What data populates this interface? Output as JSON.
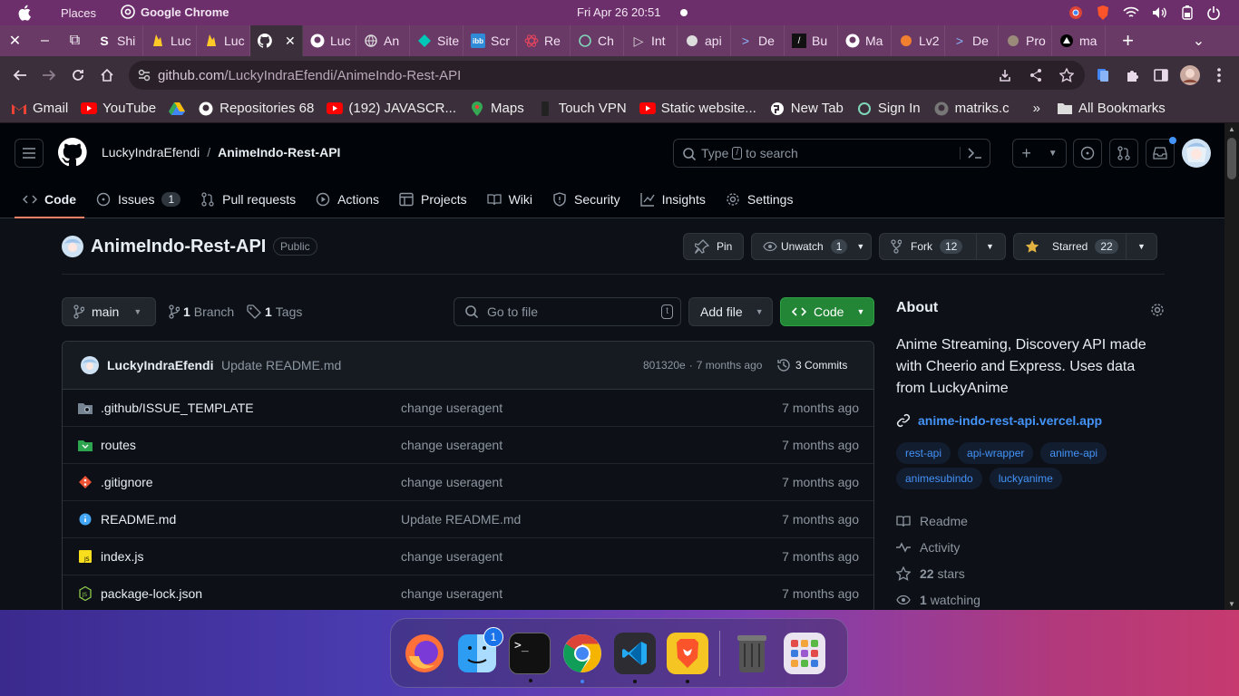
{
  "system": {
    "places": "Places",
    "app_name": "Google Chrome",
    "clock": "Fri Apr 26  20:51"
  },
  "tabs": [
    {
      "label": "Shi",
      "icon": "s-icon"
    },
    {
      "label": "Luc",
      "icon": "firebase-icon"
    },
    {
      "label": "Luc",
      "icon": "firebase-icon"
    },
    {
      "label": "",
      "icon": "github-icon",
      "active": true
    },
    {
      "label": "Luc",
      "icon": "github-icon"
    },
    {
      "label": "An",
      "icon": "globe-icon"
    },
    {
      "label": "Site",
      "icon": "diamond-icon"
    },
    {
      "label": "Scr",
      "icon": "ibb-icon"
    },
    {
      "label": "Re",
      "icon": "react-icon"
    },
    {
      "label": "Ch",
      "icon": "openai-icon"
    },
    {
      "label": "Int",
      "icon": "play-icon"
    },
    {
      "label": "api",
      "icon": "globe-icon"
    },
    {
      "label": "De",
      "icon": "powershell-icon"
    },
    {
      "label": "Bu",
      "icon": "box-icon"
    },
    {
      "label": "Ma",
      "icon": "github-icon"
    },
    {
      "label": "Lv2",
      "icon": "ball-icon"
    },
    {
      "label": "De",
      "icon": "powershell-icon"
    },
    {
      "label": "Pro",
      "icon": "gear-icon"
    },
    {
      "label": "ma",
      "icon": "triangle-icon"
    }
  ],
  "address": {
    "host": "github.com",
    "path": "/LuckyIndraEfendi/AnimeIndo-Rest-API"
  },
  "bookmarks": [
    {
      "label": "Gmail",
      "icon": "gmail-icon"
    },
    {
      "label": "YouTube",
      "icon": "youtube-icon"
    },
    {
      "label": "",
      "icon": "drive-icon"
    },
    {
      "label": "Repositories 68",
      "icon": "github-icon"
    },
    {
      "label": "(192) JAVASCR...",
      "icon": "youtube-icon"
    },
    {
      "label": "Maps",
      "icon": "maps-icon"
    },
    {
      "label": "Touch VPN",
      "icon": "vpn-icon"
    },
    {
      "label": "Static website...",
      "icon": "youtube-icon"
    },
    {
      "label": "New Tab",
      "icon": "globe-icon"
    },
    {
      "label": "Sign In",
      "icon": "openai-icon"
    },
    {
      "label": "matriks.c",
      "icon": "github-icon"
    }
  ],
  "all_bookmarks": "All Bookmarks",
  "github": {
    "owner": "LuckyIndraEfendi",
    "separator": "/",
    "repo": "AnimeIndo-Rest-API",
    "search_placeholder_a": "Type",
    "search_key": "/",
    "search_placeholder_b": "to search",
    "nav": [
      {
        "label": "Code",
        "icon": "code-icon",
        "selected": true
      },
      {
        "label": "Issues",
        "icon": "issue-icon",
        "count": "1"
      },
      {
        "label": "Pull requests",
        "icon": "pull-request-icon"
      },
      {
        "label": "Actions",
        "icon": "play-icon"
      },
      {
        "label": "Projects",
        "icon": "table-icon"
      },
      {
        "label": "Wiki",
        "icon": "book-icon"
      },
      {
        "label": "Security",
        "icon": "shield-icon"
      },
      {
        "label": "Insights",
        "icon": "graph-icon"
      },
      {
        "label": "Settings",
        "icon": "gear-icon"
      }
    ]
  },
  "repo": {
    "name": "AnimeIndo-Rest-API",
    "visibility": "Public",
    "pin": "Pin",
    "unwatch": "Unwatch",
    "watch_count": "1",
    "fork": "Fork",
    "fork_count": "12",
    "starred": "Starred",
    "star_count": "22",
    "branch": "main",
    "branches_count": "1",
    "branches_label": "Branch",
    "tags_count": "1",
    "tags_label": "Tags",
    "goto_placeholder": "Go to file",
    "goto_key": "t",
    "add_file": "Add file",
    "code_btn": "Code"
  },
  "commit": {
    "author": "LuckyIndraEfendi",
    "message": "Update README.md",
    "hash": "801320e",
    "sep": "·",
    "time": "7 months ago",
    "count": "3 Commits"
  },
  "files": [
    {
      "name": ".github/ISSUE_TEMPLATE",
      "message": "change useragent",
      "date": "7 months ago",
      "icon": "folder-icon"
    },
    {
      "name": "routes",
      "message": "change useragent",
      "date": "7 months ago",
      "icon": "folder-icon"
    },
    {
      "name": ".gitignore",
      "message": "change useragent",
      "date": "7 months ago",
      "icon": "git-icon"
    },
    {
      "name": "README.md",
      "message": "Update README.md",
      "date": "7 months ago",
      "icon": "info-icon"
    },
    {
      "name": "index.js",
      "message": "change useragent",
      "date": "7 months ago",
      "icon": "js-icon"
    },
    {
      "name": "package-lock.json",
      "message": "change useragent",
      "date": "7 months ago",
      "icon": "nodejs-icon"
    }
  ],
  "about": {
    "heading": "About",
    "description": "Anime Streaming, Discovery API made with Cheerio and Express. Uses data from LuckyAnime",
    "link": "anime-indo-rest-api.vercel.app",
    "topics": [
      "rest-api",
      "api-wrapper",
      "anime-api",
      "animesubindo",
      "luckyanime"
    ],
    "readme": "Readme",
    "activity": "Activity",
    "stars_count": "22",
    "stars_label": "stars",
    "watching_count": "1",
    "watching_label": "watching"
  },
  "dock": {
    "apps": [
      {
        "name": "firefox-icon"
      },
      {
        "name": "finder-icon",
        "badge": "1"
      },
      {
        "name": "terminal-icon"
      },
      {
        "name": "chrome-icon"
      },
      {
        "name": "vscode-icon"
      },
      {
        "name": "brave-icon"
      },
      {
        "name": "trash-icon"
      },
      {
        "name": "launchpad-icon"
      }
    ],
    "terminal_glyph": ">_"
  },
  "colors": {
    "github_bg": "#0d1117",
    "header_bg": "#010409",
    "accent_green": "#238636",
    "link_blue": "#4493f8",
    "tab_underline": "#f78166",
    "chrome_frame": "#6a3a67"
  }
}
